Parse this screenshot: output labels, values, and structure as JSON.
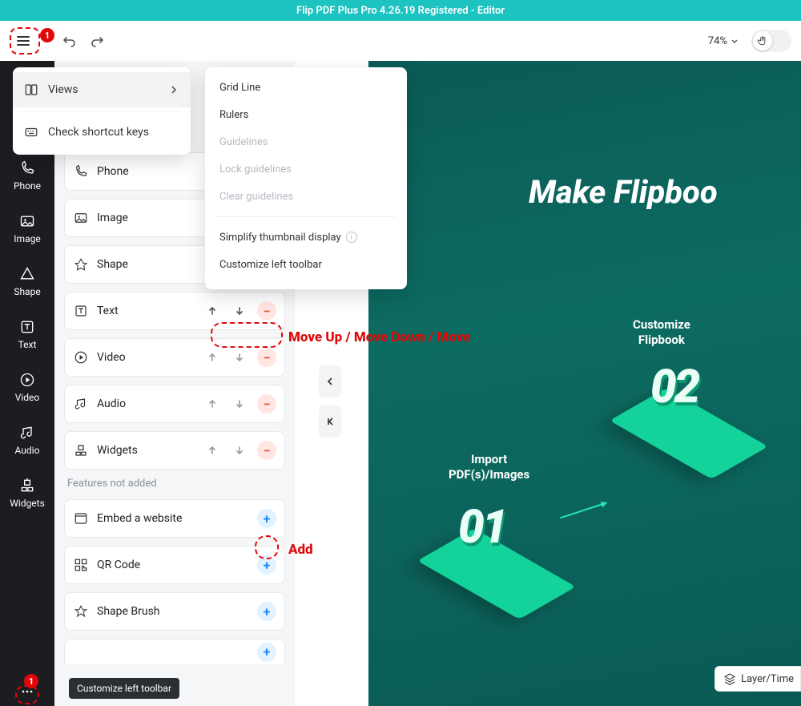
{
  "app": {
    "title": "Flip PDF Plus Pro 4.26.19 Registered - Editor"
  },
  "toolbar": {
    "zoom": "74%"
  },
  "menu1": {
    "views": "Views",
    "shortcut": "Check shortcut keys"
  },
  "menu2": {
    "grid": "Grid Line",
    "rulers": "Rulers",
    "guidelines": "Guidelines",
    "lock": "Lock guidelines",
    "clear": "Clear guidelines",
    "simplify": "Simplify thumbnail display",
    "custom": "Customize left toolbar"
  },
  "sidebar": {
    "items": [
      {
        "label": "Phone"
      },
      {
        "label": "Image"
      },
      {
        "label": "Shape"
      },
      {
        "label": "Text"
      },
      {
        "label": "Video"
      },
      {
        "label": "Audio"
      },
      {
        "label": "Widgets"
      }
    ]
  },
  "customize": {
    "rows_added": [
      {
        "label": "Phone",
        "icon": "phone"
      },
      {
        "label": "Image",
        "icon": "image"
      },
      {
        "label": "Shape",
        "icon": "shape"
      },
      {
        "label": "Text",
        "icon": "text"
      },
      {
        "label": "Video",
        "icon": "video"
      },
      {
        "label": "Audio",
        "icon": "audio"
      },
      {
        "label": "Widgets",
        "icon": "widgets"
      }
    ],
    "section_not_added": "Features not added",
    "rows_not_added": [
      {
        "label": "Embed a website",
        "icon": "embed"
      },
      {
        "label": "QR Code",
        "icon": "qr"
      },
      {
        "label": "Shape Brush",
        "icon": "shapebrush"
      },
      {
        "label": "",
        "icon": "blank"
      }
    ]
  },
  "annotations": {
    "move": "Move Up / Move Down / Move",
    "add": "Add"
  },
  "tooltip": {
    "customize": "Customize left toolbar"
  },
  "canvas": {
    "headline": "Make Flipboo",
    "feat1": "Import\nPDF(s)/Images",
    "feat2": "Customize\nFlipbook",
    "num1": "01",
    "num2": "02",
    "layer": "Layer/Time"
  }
}
